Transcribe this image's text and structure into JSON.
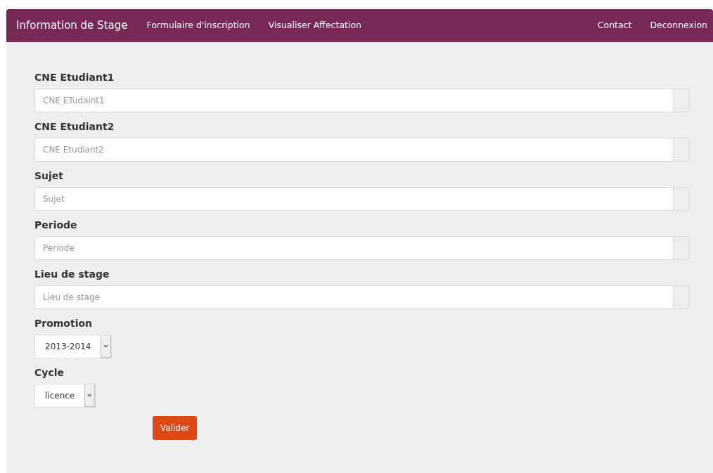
{
  "navbar": {
    "brand": "Information de Stage",
    "left_links": [
      "Formulaire d'inscription",
      "Visualiser Affectation"
    ],
    "right_links": [
      "Contact",
      "Deconnexion"
    ]
  },
  "form": {
    "fields": [
      {
        "kind": "text",
        "label": "CNE Etudiant1",
        "placeholder": "CNE ETudaint1"
      },
      {
        "kind": "text",
        "label": "CNE Etudiant2",
        "placeholder": "CNE Etudiant2"
      },
      {
        "kind": "text",
        "label": "Sujet",
        "placeholder": "Sujet"
      },
      {
        "kind": "text",
        "label": "Periode",
        "placeholder": "Periode"
      },
      {
        "kind": "text",
        "label": "Lieu de stage",
        "placeholder": "Lieu de stage"
      },
      {
        "kind": "select",
        "label": "Promotion",
        "value": "2013-2014"
      },
      {
        "kind": "select",
        "label": "Cycle",
        "value": "licence"
      }
    ],
    "submit": "Valider"
  }
}
